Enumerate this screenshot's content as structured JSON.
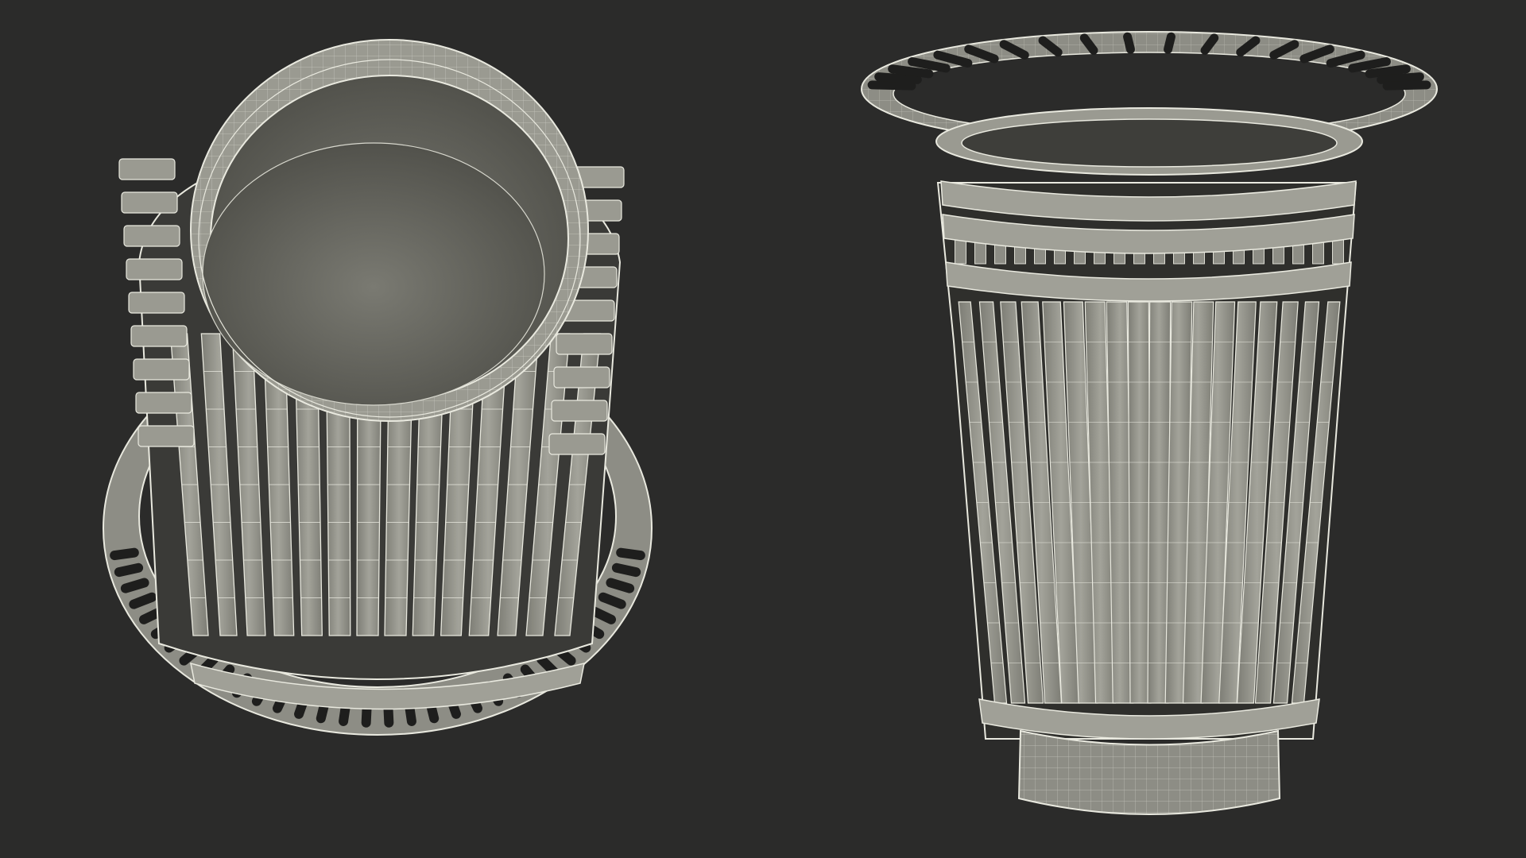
{
  "scene": {
    "description_visible_text": "",
    "background_color": "#2b2b2a",
    "model_color": "#8f8f86",
    "wire_color": "#e9e9df",
    "interior_color": "#5f5f58",
    "views": [
      {
        "id": "top-perspective",
        "subject": "trash-bin-wireframe",
        "slat_count": 28
      },
      {
        "id": "front-perspective",
        "subject": "trash-bin-wireframe",
        "slat_count": 22
      }
    ]
  }
}
